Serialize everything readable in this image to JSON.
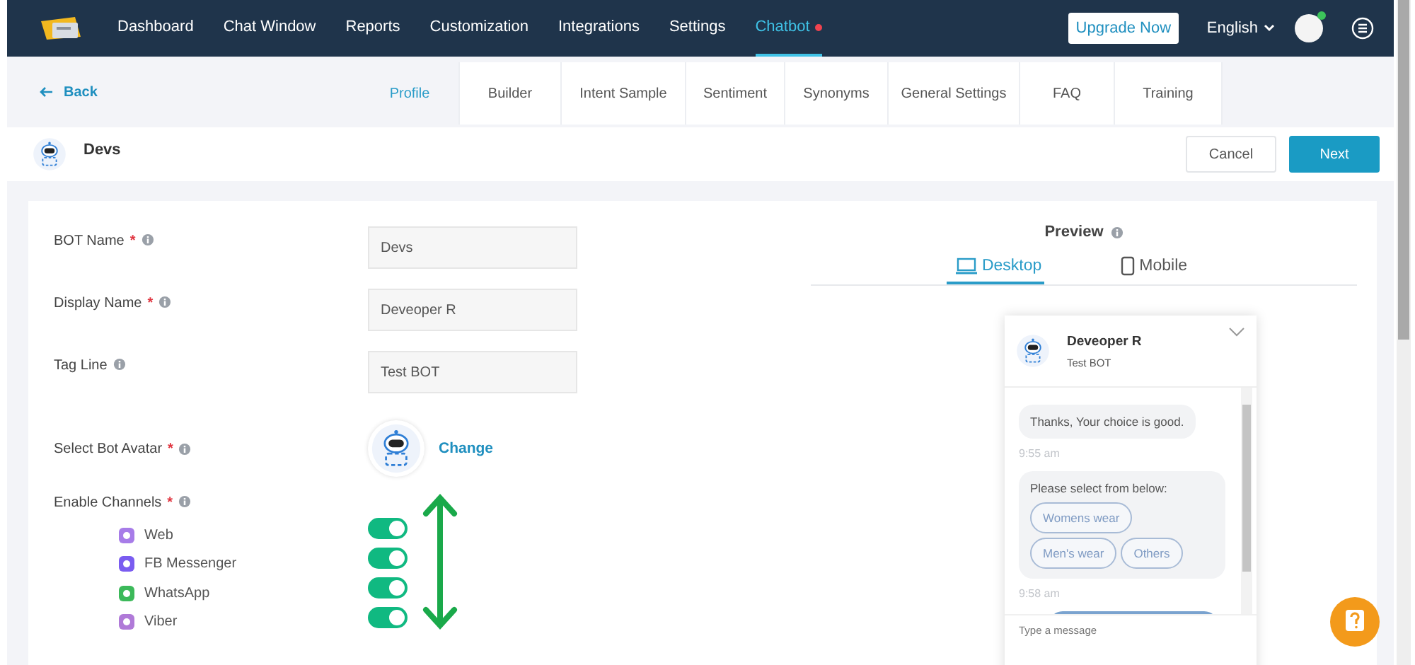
{
  "nav": {
    "items": [
      {
        "label": "Dashboard",
        "selected": false,
        "dot": false
      },
      {
        "label": "Chat Window",
        "selected": false,
        "dot": false
      },
      {
        "label": "Reports",
        "selected": false,
        "dot": false
      },
      {
        "label": "Customization",
        "selected": false,
        "dot": false
      },
      {
        "label": "Integrations",
        "selected": false,
        "dot": false
      },
      {
        "label": "Settings",
        "selected": false,
        "dot": false
      },
      {
        "label": "Chatbot",
        "selected": true,
        "dot": true
      }
    ],
    "upgrade_button": "Upgrade Now",
    "language": "English"
  },
  "subnav": {
    "back": "Back",
    "tabs": [
      {
        "label": "Profile",
        "selected": true
      },
      {
        "label": "Builder",
        "selected": false
      },
      {
        "label": "Intent Sample",
        "selected": false
      },
      {
        "label": "Sentiment",
        "selected": false
      },
      {
        "label": "Synonyms",
        "selected": false
      },
      {
        "label": "General Settings",
        "selected": false
      },
      {
        "label": "FAQ",
        "selected": false
      },
      {
        "label": "Training",
        "selected": false
      }
    ]
  },
  "header": {
    "title": "Devs",
    "cancel_button": "Cancel",
    "next_button": "Next"
  },
  "form": {
    "fields": [
      {
        "kind": "text",
        "label": "BOT Name",
        "marker": "*",
        "value": "Devs"
      },
      {
        "kind": "text",
        "label": "Display Name",
        "marker": "*",
        "value": "Deveoper R"
      },
      {
        "kind": "text",
        "label": "Tag Line",
        "value": "Test BOT"
      },
      {
        "kind": "avatar",
        "label": "Select Bot Avatar",
        "marker": "*",
        "action": "Change"
      }
    ],
    "channels": {
      "label": "Enable Channels",
      "marker": "*",
      "items": [
        {
          "name": "Web",
          "color": "#a77ce8",
          "on": true
        },
        {
          "name": "FB Messenger",
          "color": "#7a5cf0",
          "on": true
        },
        {
          "name": "WhatsApp",
          "color": "#3cb95a",
          "on": true
        },
        {
          "name": "Viber",
          "color": "#b07ad8",
          "on": true
        }
      ]
    }
  },
  "preview": {
    "title": "Preview",
    "tabs": [
      {
        "label": "Desktop",
        "kind": "desktop",
        "selected": true
      },
      {
        "label": "Mobile",
        "kind": "mobile",
        "selected": false
      }
    ],
    "chat": {
      "name": "Deveoper R",
      "tagline": "Test BOT",
      "messages": [
        {
          "kind": "bot",
          "text": "Thanks, Your choice is good."
        },
        {
          "kind": "time",
          "text": "9:55 am"
        },
        {
          "kind": "options",
          "text": "Please select from below:",
          "options": [
            "Womens wear",
            "Men's wear",
            "Others"
          ]
        },
        {
          "kind": "time",
          "text": "9:58 am"
        },
        {
          "kind": "user"
        }
      ],
      "placeholder": "Type a message"
    }
  }
}
